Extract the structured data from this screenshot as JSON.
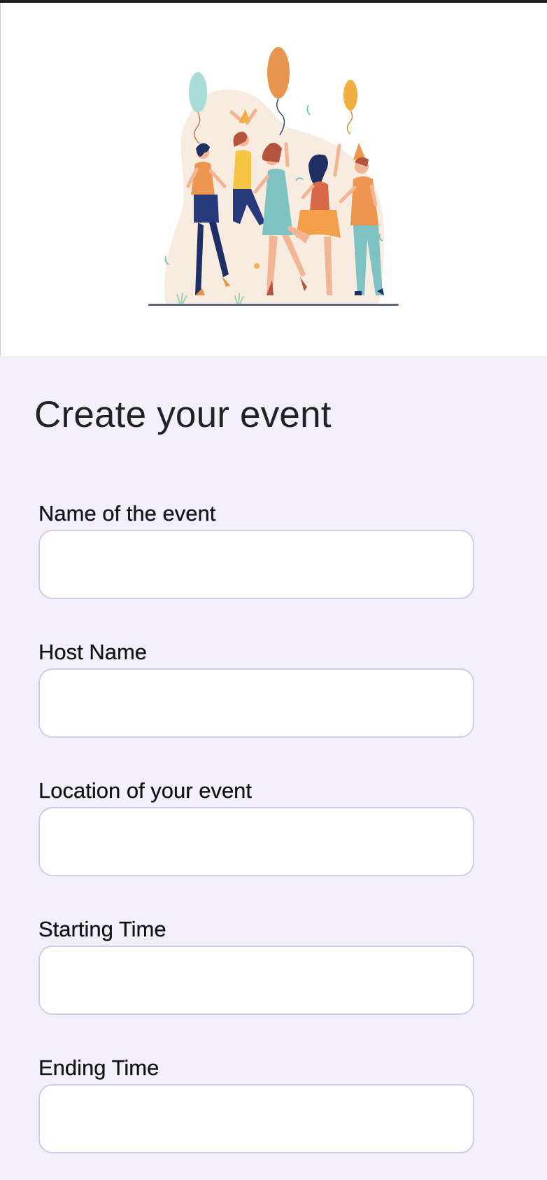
{
  "form": {
    "title": "Create your event",
    "fields": [
      {
        "label": "Name of the event",
        "value": "",
        "placeholder": ""
      },
      {
        "label": "Host Name",
        "value": "",
        "placeholder": ""
      },
      {
        "label": "Location of your event",
        "value": "",
        "placeholder": ""
      },
      {
        "label": "Starting Time",
        "value": "",
        "placeholder": ""
      },
      {
        "label": "Ending Time",
        "value": "",
        "placeholder": ""
      }
    ]
  },
  "colors": {
    "form_background": "#f3f0fc",
    "input_border": "#d2cbec",
    "title_text": "#222226"
  },
  "hero": {
    "illustration": "party-people-dancing-with-balloons"
  }
}
